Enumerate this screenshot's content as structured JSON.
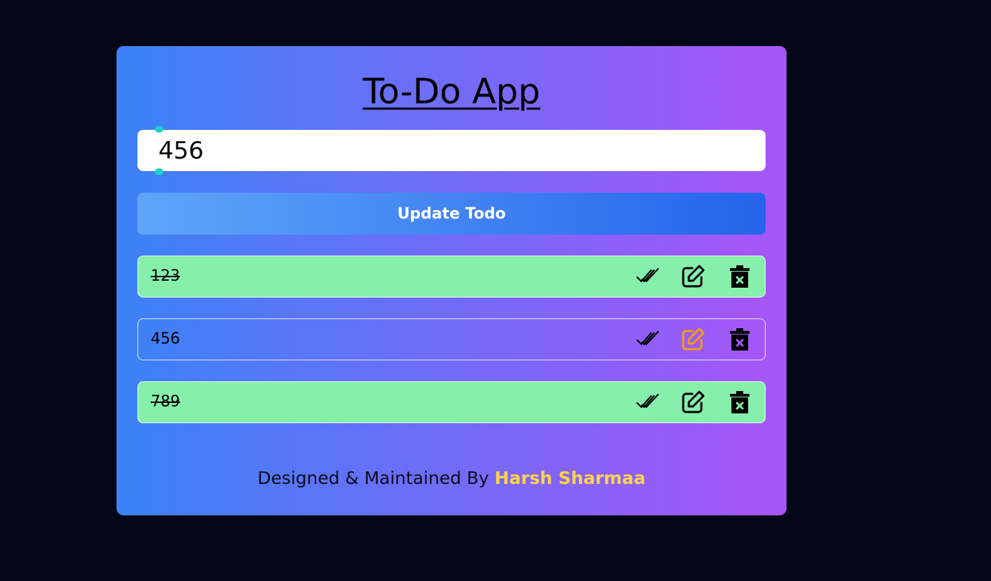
{
  "app": {
    "title": "To-Do App"
  },
  "input": {
    "value": "456",
    "placeholder": ""
  },
  "update_button": {
    "label": "Update Todo"
  },
  "todos": [
    {
      "text": "123",
      "completed": true,
      "editing": false
    },
    {
      "text": "456",
      "completed": false,
      "editing": true
    },
    {
      "text": "789",
      "completed": true,
      "editing": false
    }
  ],
  "icons": {
    "complete": "double-check-icon",
    "edit": "edit-icon",
    "delete": "trash-icon"
  },
  "footer": {
    "prefix": "Designed & Maintained By",
    "author": "Harsh Sharmaa"
  },
  "colors": {
    "background": "#020617",
    "card_gradient_start": "#3b82f6",
    "card_gradient_end": "#a855f7",
    "completed_item": "#86efac",
    "editing_icon": "#f59e0b",
    "author": "#fcd34d",
    "button_gradient_start": "#60a5fa",
    "button_gradient_end": "#2563eb"
  }
}
